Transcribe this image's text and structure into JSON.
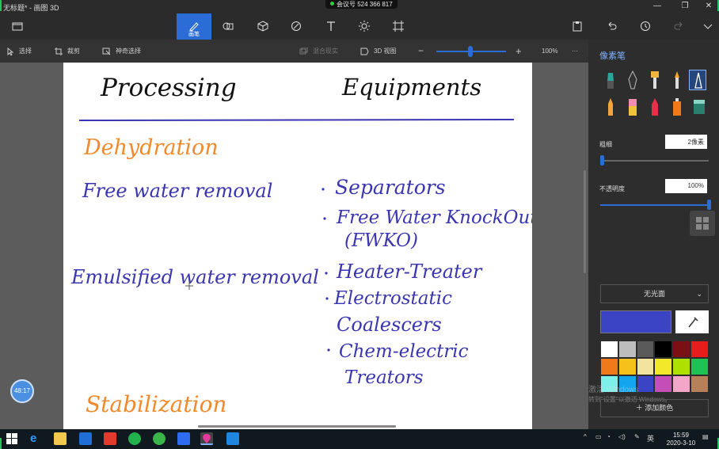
{
  "window": {
    "title": "无标题* - 画图 3D"
  },
  "meeting": {
    "label": "会议号 524 366 817"
  },
  "ribbon": {
    "tools": [
      {
        "name": "menu",
        "label": ""
      },
      {
        "name": "brushes",
        "label": "画笔",
        "active": true
      },
      {
        "name": "2d-shapes",
        "label": ""
      },
      {
        "name": "3d-shapes",
        "label": ""
      },
      {
        "name": "stickers",
        "label": ""
      },
      {
        "name": "text",
        "label": ""
      },
      {
        "name": "effects",
        "label": ""
      },
      {
        "name": "canvas",
        "label": ""
      }
    ]
  },
  "toolbar": {
    "select": "选择",
    "crop": "裁剪",
    "magic_select": "神奇选择",
    "mixed_reality": "混合现实",
    "view_3d": "3D 视图",
    "zoom": "100%",
    "zoom_percent": 45
  },
  "canvas": {
    "headers": [
      "Processing",
      "Equipments"
    ],
    "sections": {
      "dehydration": "Dehydration",
      "stabilization": "Stabilization"
    },
    "processes": [
      "Free water removal",
      "Emulsified water removal"
    ],
    "equipment": [
      "Separators",
      "Free Water KnockOut",
      "(FWKO)",
      "Heater-Treater",
      "Electrostatic",
      "Coalescers",
      "Chem-electric",
      "Treators"
    ],
    "timer": "48:17",
    "ink_colors": {
      "heading": "#111111",
      "section": "#f08a2a",
      "body": "#3a35b0",
      "rule": "#3a35b0"
    }
  },
  "panel": {
    "title": "像素笔",
    "thickness_label": "粗细",
    "thickness_value": "2像素",
    "thickness_fraction": 0.02,
    "opacity_label": "不透明度",
    "opacity_value": "100%",
    "opacity_fraction": 1.0,
    "finish": "无光面",
    "add_color": "添加颜色",
    "current_color": "#3b44c4",
    "watermark_line1": "激活 Windows",
    "watermark_line2": "转到\"设置\"以激活 Windows。",
    "brushes": [
      "marker",
      "calligraphy-pen",
      "oil-brush",
      "watercolor",
      "pixel-pen",
      "pencil",
      "eraser",
      "crayon",
      "spraycan",
      "fill"
    ],
    "swatches": [
      "#ffffff",
      "#bdbdbd",
      "#5a5a5a",
      "#000000",
      "#7a0f14",
      "#e81c1c",
      "#f07a1a",
      "#f7c11b",
      "#f3e3a0",
      "#f4e82a",
      "#aee000",
      "#1fc254",
      "#7ef0ea",
      "#13a6ee",
      "#3b44c4",
      "#c54db8",
      "#f4a6c8",
      "#b5805a"
    ]
  },
  "taskbar": {
    "time": "15:59",
    "date": "2020-3-10",
    "ime": "英"
  }
}
